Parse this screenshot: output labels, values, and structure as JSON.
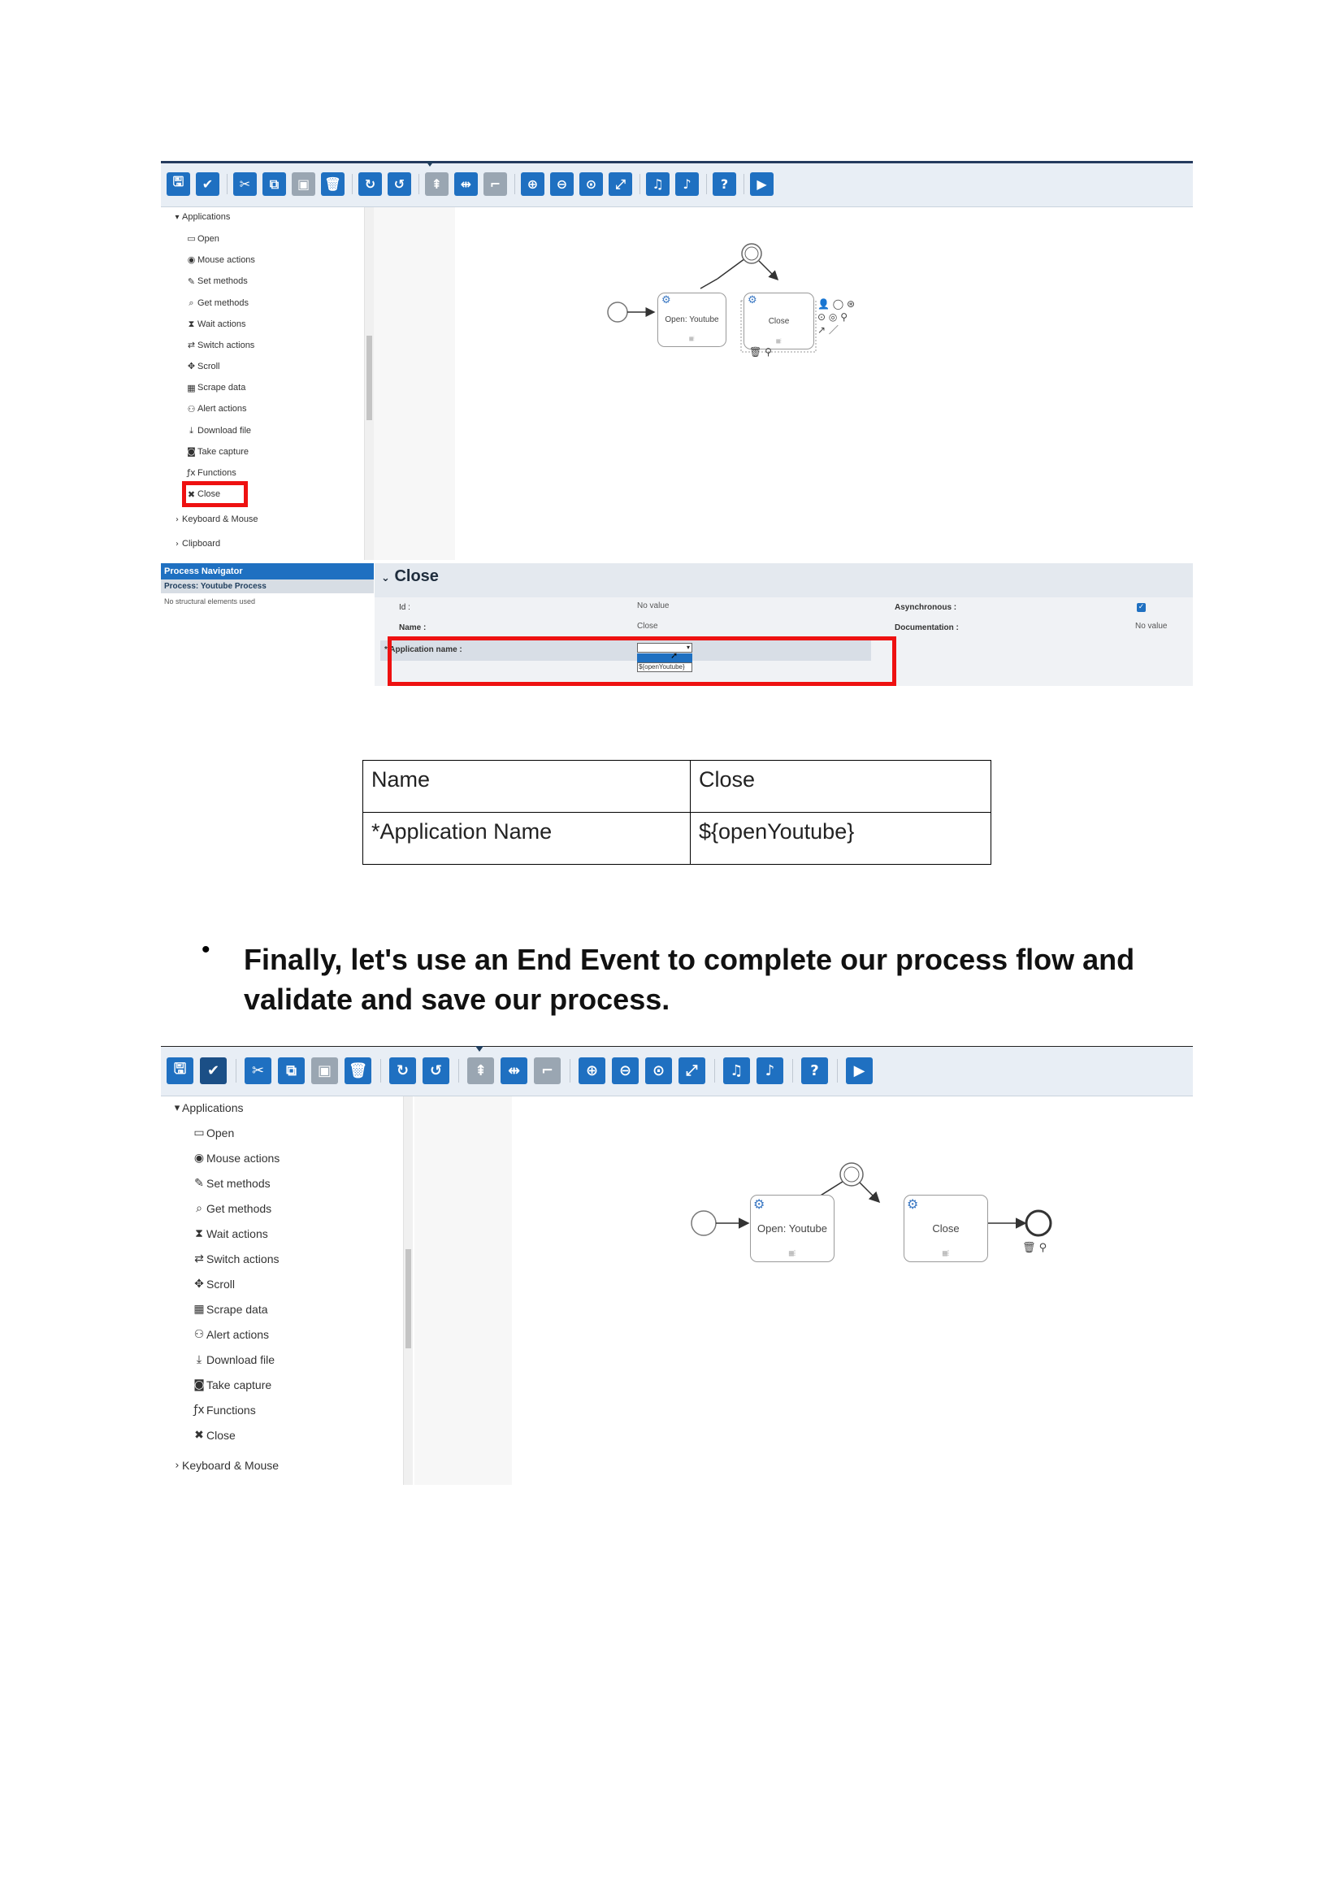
{
  "screenshot1": {
    "toolbar_buttons": [
      {
        "name": "save-icon",
        "glyph": "🖫"
      },
      {
        "name": "validate-icon",
        "glyph": "✔"
      },
      {
        "name": "cut-icon",
        "glyph": "✂"
      },
      {
        "name": "copy-icon",
        "glyph": "⧉"
      },
      {
        "name": "paste-icon",
        "glyph": "▣"
      },
      {
        "name": "delete-icon",
        "glyph": "🗑"
      },
      {
        "name": "redo-icon",
        "glyph": "↻"
      },
      {
        "name": "undo-icon",
        "glyph": "↺"
      },
      {
        "name": "align-icon",
        "glyph": "⇞"
      },
      {
        "name": "distribute-icon",
        "glyph": "⇹"
      },
      {
        "name": "connect-icon",
        "glyph": "⌐"
      },
      {
        "name": "zoom-in-icon",
        "glyph": "⊕"
      },
      {
        "name": "zoom-out-icon",
        "glyph": "⊖"
      },
      {
        "name": "zoom-reset-icon",
        "glyph": "⊙"
      },
      {
        "name": "fit-icon",
        "glyph": "⤢"
      },
      {
        "name": "import-icon",
        "glyph": "♫"
      },
      {
        "name": "export-icon",
        "glyph": "♪"
      },
      {
        "name": "help-icon",
        "glyph": "?"
      },
      {
        "name": "run-icon",
        "glyph": "▶"
      }
    ],
    "tree": {
      "group": "Applications",
      "items": [
        {
          "label": "Open",
          "icon": "window-icon",
          "glyph": "▭"
        },
        {
          "label": "Mouse actions",
          "icon": "mouse-icon",
          "glyph": "◉"
        },
        {
          "label": "Set methods",
          "icon": "pencil-icon",
          "glyph": "✎"
        },
        {
          "label": "Get methods",
          "icon": "search-doc-icon",
          "glyph": "⌕"
        },
        {
          "label": "Wait actions",
          "icon": "hourglass-icon",
          "glyph": "⧗"
        },
        {
          "label": "Switch actions",
          "icon": "switch-icon",
          "glyph": "⇄"
        },
        {
          "label": "Scroll",
          "icon": "scroll-icon",
          "glyph": "✥"
        },
        {
          "label": "Scrape data",
          "icon": "table-icon",
          "glyph": "▦"
        },
        {
          "label": "Alert actions",
          "icon": "alert-icon",
          "glyph": "⚇"
        },
        {
          "label": "Download file",
          "icon": "download-icon",
          "glyph": "⤓"
        },
        {
          "label": "Take capture",
          "icon": "camera-icon",
          "glyph": "◙"
        },
        {
          "label": "Functions",
          "icon": "fx-icon",
          "glyph": "ƒx"
        },
        {
          "label": "Close",
          "icon": "close-icon",
          "glyph": "✖"
        }
      ],
      "groups_after": [
        "Keyboard & Mouse",
        "Clipboard"
      ]
    },
    "diagram": {
      "task1": "Open: Youtube",
      "task2": "Close"
    },
    "navigator": {
      "title": "Process Navigator",
      "process": "Process: Youtube Process",
      "empty": "No structural elements used"
    },
    "properties": {
      "title": "Close",
      "id_label": "Id :",
      "id_value": "No value",
      "name_label": "Name :",
      "name_value": "Close",
      "app_label": "* Application name :",
      "async_label": "Asynchronous :",
      "doc_label": "Documentation :",
      "doc_value": "No value",
      "dropdown_option": "${openYoutube}"
    }
  },
  "table": {
    "rows": [
      [
        "Name",
        "Close"
      ],
      [
        "*Application Name",
        "${openYoutube}"
      ]
    ]
  },
  "instruction": {
    "bullet": "•",
    "text": "Finally, let's use an End Event to complete our process flow and validate and save our process."
  },
  "screenshot2": {
    "tree": {
      "group": "Applications",
      "items": [
        {
          "label": "Open",
          "icon": "window-icon",
          "glyph": "▭"
        },
        {
          "label": "Mouse actions",
          "icon": "mouse-icon",
          "glyph": "◉"
        },
        {
          "label": "Set methods",
          "icon": "pencil-icon",
          "glyph": "✎"
        },
        {
          "label": "Get methods",
          "icon": "search-doc-icon",
          "glyph": "⌕"
        },
        {
          "label": "Wait actions",
          "icon": "hourglass-icon",
          "glyph": "⧗"
        },
        {
          "label": "Switch actions",
          "icon": "switch-icon",
          "glyph": "⇄"
        },
        {
          "label": "Scroll",
          "icon": "scroll-icon",
          "glyph": "✥"
        },
        {
          "label": "Scrape data",
          "icon": "table-icon",
          "glyph": "▦"
        },
        {
          "label": "Alert actions",
          "icon": "alert-icon",
          "glyph": "⚇"
        },
        {
          "label": "Download file",
          "icon": "download-icon",
          "glyph": "⤓"
        },
        {
          "label": "Take capture",
          "icon": "camera-icon",
          "glyph": "◙"
        },
        {
          "label": "Functions",
          "icon": "fx-icon",
          "glyph": "ƒx"
        },
        {
          "label": "Close",
          "icon": "close-icon",
          "glyph": "✖"
        }
      ],
      "groups_after": [
        "Keyboard & Mouse"
      ]
    },
    "diagram": {
      "task1": "Open: Youtube",
      "task2": "Close"
    }
  },
  "colors": {
    "toolbar_button": "#1f70c1",
    "highlight": "#ee1111",
    "navigator_header": "#1f70c1"
  }
}
